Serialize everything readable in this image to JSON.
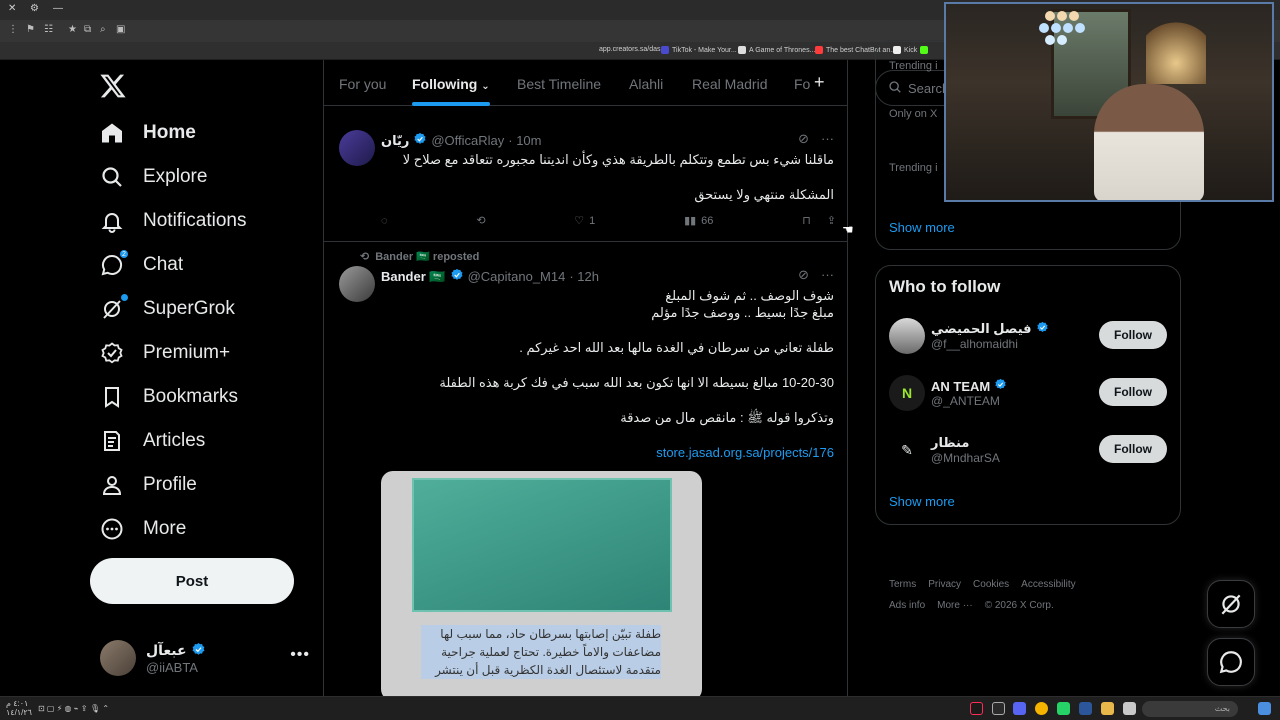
{
  "browser": {
    "bookmarks": [
      {
        "label": "app.creators.sa/das...",
        "color": "#888888"
      },
      {
        "label": "TikTok - Make Your...",
        "color": "#ff2c55"
      },
      {
        "label": "A Game of Thrones...",
        "color": "#ffffff"
      },
      {
        "label": "The best ChatBot an...",
        "color": "#ff3b3b"
      },
      {
        "label": "Kick",
        "color": "#53fc18"
      }
    ]
  },
  "nav": {
    "items": [
      {
        "label": "Home",
        "icon": "home-icon",
        "active": true
      },
      {
        "label": "Explore",
        "icon": "search-icon"
      },
      {
        "label": "Notifications",
        "icon": "bell-icon"
      },
      {
        "label": "Chat",
        "icon": "chat-icon",
        "badge": "2"
      },
      {
        "label": "SuperGrok",
        "icon": "grok-icon"
      },
      {
        "label": "Premium+",
        "icon": "premium-icon"
      },
      {
        "label": "Bookmarks",
        "icon": "bookmark-icon"
      },
      {
        "label": "Articles",
        "icon": "article-icon"
      },
      {
        "label": "Profile",
        "icon": "person-icon"
      },
      {
        "label": "More",
        "icon": "more-circle-icon"
      }
    ],
    "post_label": "Post",
    "account": {
      "name": "عبعآل",
      "handle": "@iiABTA"
    }
  },
  "tabs": [
    "For you",
    "Following",
    "Best Timeline",
    "Alahli",
    "Real Madrid",
    "Fo"
  ],
  "tweet1": {
    "name": "ريّان",
    "handle": "@OfficaRlay",
    "time": "· 10m",
    "line1": "ماقلنا شيء بس تطمع وتتكلم بالطريقة هذي وكأن انديتنا مجبوره تتعاقد مع صلاح لا",
    "line2": "المشكلة منتهي ولا يستحق",
    "likes": "1",
    "views": "66"
  },
  "tweet2": {
    "repost_label": "Bander 🇸🇦 reposted",
    "name": "Bander 🇸🇦",
    "handle": "@Capitano_M14",
    "time": "· 12h",
    "line1": "شوف الوصف .. ثم شوف المبلغ",
    "line2": "مبلغ جدًا بسيط .. ووصف جدًا مؤلم",
    "line3": "طفلة تعاني من سرطان في الغدة مالها بعد الله احد غيركم .",
    "line4": "10-20-30 مبالغ بسيطه الا انها تكون بعد الله سبب في فك كربة هذه الطفلة",
    "line5": "وتذكروا قوله ﷺ : مانقص مال من صدقة",
    "link": "store.jasad.org.sa/projects/176",
    "media_text": "طفلة تبيّن إصابتها بسرطان حاد، مما سبب لها مضاعفات والاماً خطيرة. تحتاج لعملية جراحية متقدمة لاستئصال الغدة الكظرية قبل أن ينتشر"
  },
  "right": {
    "search_placeholder": "Search",
    "trending_header": "Trending i",
    "only_on": "Only on X",
    "trending_label": "Trending i",
    "show_more": "Show more",
    "who_to_follow": "Who to follow",
    "follow_label": "Follow",
    "suggestions": [
      {
        "name": "فيصل الحميضي",
        "handle": "@f__alhomaidhi",
        "verified": true
      },
      {
        "name": "AN TEAM",
        "handle": "@_ANTEAM",
        "verified": true
      },
      {
        "name": "منظار",
        "handle": "@MndharSA",
        "verified": false
      }
    ],
    "footer_row1": [
      "Terms",
      "Privacy",
      "Cookies",
      "Accessibility"
    ],
    "footer_row2": [
      "Ads info",
      "More ···",
      "© 2026 X Corp."
    ]
  },
  "taskbar": {
    "time": "٤:٠١ م",
    "date": "١٤/١/٢٦",
    "search_placeholder": "بحث"
  }
}
